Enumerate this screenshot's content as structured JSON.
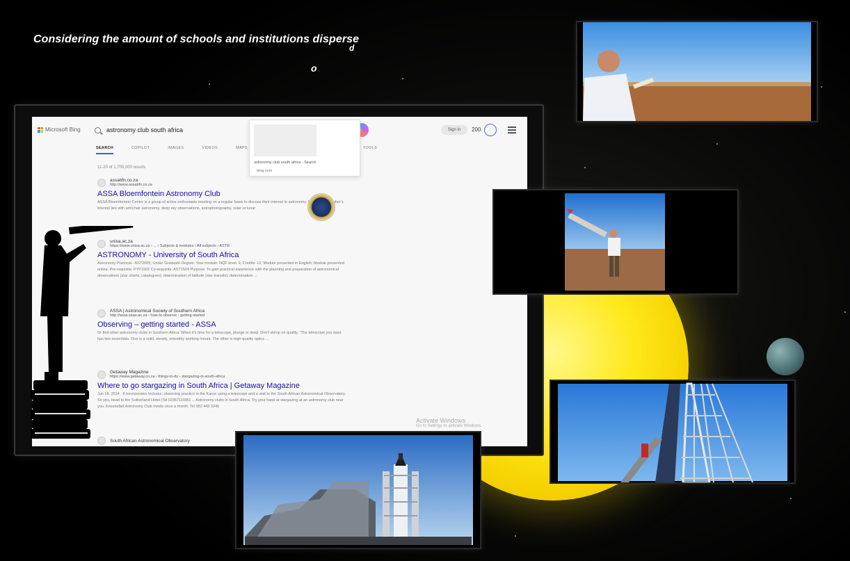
{
  "caption": {
    "text": "Considering the amount of schools and institutions disperse",
    "stray_letter_d": "d",
    "stray_letter_o": "o"
  },
  "browser": {
    "brand": "Microsoft Bing",
    "search_query": "astronomy club south africa",
    "signin_label": "Sign in",
    "reward_points": "200",
    "tabs": [
      "SEARCH",
      "COPILOT",
      "IMAGES",
      "VIDEOS",
      "MAPS"
    ],
    "active_tab": "SEARCH",
    "tabs_hidden_label": "TOOLS",
    "autocomplete": {
      "suggestion": "astronomy club south africa - Search",
      "source": "bing.com"
    },
    "result_count": "11-20 of 1,700,000 results",
    "results": [
      {
        "site_name": "assabfn.co.za",
        "url": "http://www.assabfn.co.za",
        "title": "ASSA Bloemfontein Astronomy Club",
        "snippet": "ASSA Bloemfontein Centre is a group of active enthusiasts meeting on a regular basis to discuss their interest in astronomy. Whether a member's interest lies with armchair astronomy, deep sky observations, astrophotography, solar or lunar"
      },
      {
        "site_name": "unisa.ac.za",
        "url": "https://www.unisa.ac.za › ... › Subjects & modules › All subjects › ASTR",
        "title": "ASTRONOMY - University of South Africa",
        "snippet": "Astronomy Practical - AST2605; Under Graduate Degree; Year module; NQF level: 6; Credits: 12; Module presented in English; Module presented online; Pre-requisite: PYP1502 Co-requisite: AST1504 Purpose: To gain practical experience with the planning and preparation of astronomical observations (star charts, catalogues); determination of latitude (star transits); determination ..."
      },
      {
        "site_name": "ASSA | Astronomical Society of Southern Africa",
        "url": "http://assa.saao.ac.za › how-to-observe › getting-started",
        "title": "Observing – getting started - ASSA",
        "snippet": "Or find other astronomy clubs in Southern Africa. When it's time for a telescope, plunge in deep: Don't skimp on quality. \"The telescope you want has two essentials. One is a solid, steady, smoothly working mount. The other is high-quality optics ..."
      },
      {
        "site_name": "Getaway Magazine",
        "url": "https://www.getaway.co.za › things-to-do › stargazing-in-south-africa",
        "title": "Where to go stargazing in South Africa | Getaway Magazine",
        "snippet": "Jun 18, 2014 · It incorporates lectures, observing practice in the Karoo using a telescope and a visit to the South African Astronomical Observatory. So yes, head to the Sutherland Hotel (Tel 0236711096) ... Astronomy clubs in South Africa. Try your hand at stargazing at an astronomy club near you. Knoxnefad Astronomy Club meets once a month. Tel 082 443 3246"
      },
      {
        "site_name": "South African Astronomical Observatory",
        "url": "",
        "title": "",
        "snippet": ""
      }
    ],
    "watermark": {
      "title": "Activate Windows",
      "subtitle": "Go to Settings to activate Windows."
    }
  },
  "colors": {
    "sun": "#ffe81a",
    "link": "#1a0dab",
    "bing_blue": "#3463c8"
  },
  "photos": [
    {
      "name": "man-in-desert-photo"
    },
    {
      "name": "man-holding-rocket-photo"
    },
    {
      "name": "rocket-launch-tower-photo"
    },
    {
      "name": "rocket-launch-pad-photo"
    }
  ]
}
